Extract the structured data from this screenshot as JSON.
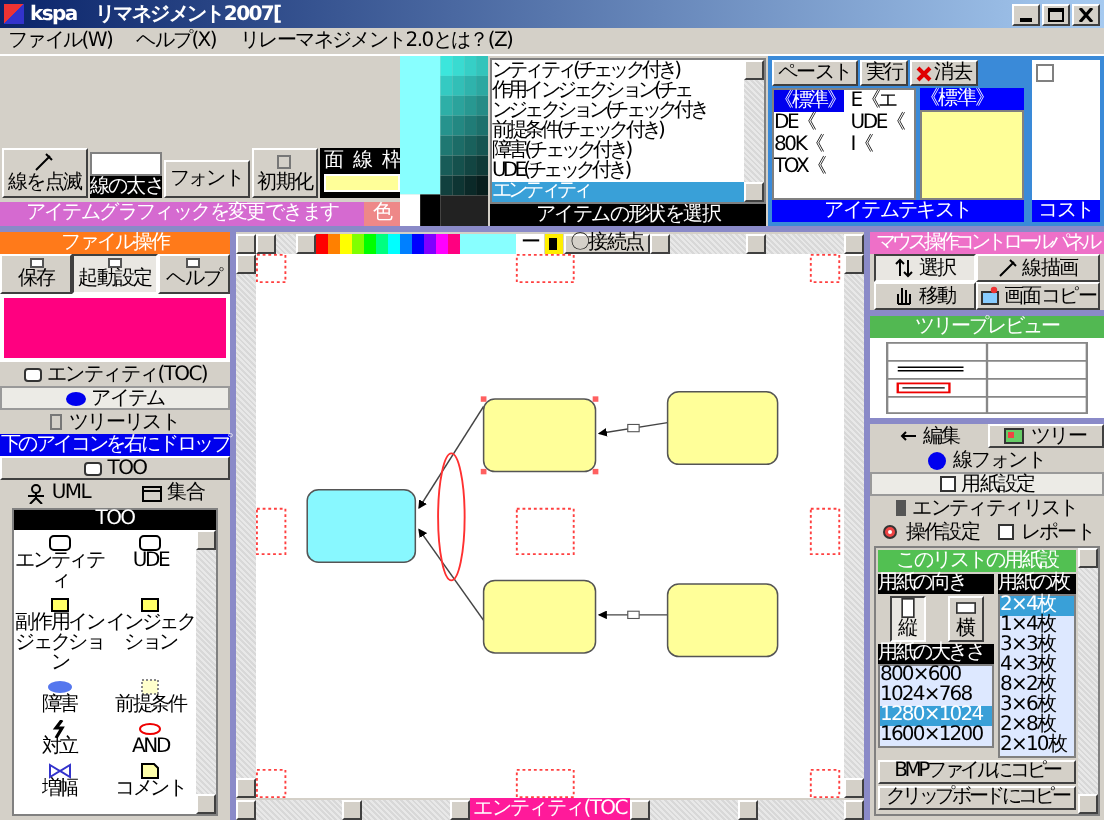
{
  "window": {
    "title": "kspa　リマネジメント2007["
  },
  "menu": [
    {
      "label": "ファイル(W)"
    },
    {
      "label": "ヘルプ(X)"
    },
    {
      "label": "リレーマネジメント2.0とは？(Z)"
    }
  ],
  "graphic_tools": {
    "blink_button": "線を点滅",
    "line_width_label": "線の太さ",
    "font_button": "フォント",
    "reset_button": "初期化",
    "swatch_labels": [
      "面",
      "線",
      "枠"
    ],
    "banner": "アイテムグラフィックを変更できます",
    "color_label": "色"
  },
  "shape_list": {
    "items": [
      {
        "label": "ンティティ(チェック付き)",
        "selected": false
      },
      {
        "label": "作用インジェクション(チェ",
        "selected": false
      },
      {
        "label": "ンジェクション(チェック付き",
        "selected": false
      },
      {
        "label": "前提条件(チェック付き)",
        "selected": false
      },
      {
        "label": "障害(チェック付き)",
        "selected": false
      },
      {
        "label": "UDE(チェック付き)",
        "selected": false
      },
      {
        "label": "エンティティ",
        "selected": true
      }
    ],
    "caption": "アイテムの形状を選択"
  },
  "item_text": {
    "styles": [
      {
        "label": "《標準》",
        "selected": true
      },
      {
        "label": "E《エ",
        "selected": false
      },
      {
        "label": "DE《",
        "selected": false
      },
      {
        "label": "UDE《",
        "selected": false
      },
      {
        "label": "80K《",
        "selected": false
      },
      {
        "label": "I《",
        "selected": false
      },
      {
        "label": "TOX《",
        "selected": false
      }
    ],
    "buttons": [
      "ペースト",
      "実行",
      "消去"
    ],
    "current_style": "《標準》",
    "caption": "アイテムテキスト"
  },
  "cost": {
    "checked": false,
    "caption": "コスト"
  },
  "file_panel": {
    "title": "ファイル操作",
    "buttons": [
      {
        "label": "保存",
        "selected": false
      },
      {
        "label": "起動設定",
        "selected": true
      },
      {
        "label": "ヘルプ",
        "selected": false
      }
    ]
  },
  "modes": [
    {
      "label": "エンティティ(TOC)",
      "kind": "entity",
      "selected": false
    },
    {
      "label": "アイテム",
      "kind": "item",
      "selected": true
    },
    {
      "label": "ツリーリスト",
      "kind": "tree",
      "selected": false
    }
  ],
  "drop_hint": "下のアイコンを右にドロップ",
  "too_button": "TOO",
  "categories": [
    {
      "label": "UML",
      "kind": "uml"
    },
    {
      "label": "集合",
      "kind": "set"
    }
  ],
  "palette": {
    "title": "TOO",
    "items": [
      {
        "label": "エンティティ",
        "kind": "entity"
      },
      {
        "label": "UDE",
        "kind": "ude"
      },
      {
        "label": "副作用インジェクション",
        "kind": "side"
      },
      {
        "label": "インジェクション",
        "kind": "injection"
      },
      {
        "label": "障害",
        "kind": "obstacle"
      },
      {
        "label": "前提条件",
        "kind": "precondition"
      },
      {
        "label": "対立",
        "kind": "conflict"
      },
      {
        "label": "AND",
        "kind": "and"
      },
      {
        "label": "増幅",
        "kind": "amplifier"
      },
      {
        "label": "コメント",
        "kind": "comment"
      }
    ]
  },
  "canvas": {
    "swatches": [
      {
        "color": "#ff0000"
      },
      {
        "color": "#ff8000"
      },
      {
        "color": "#ffff00"
      },
      {
        "color": "#80ff00"
      },
      {
        "color": "#00ff00"
      },
      {
        "color": "#00ff80"
      },
      {
        "color": "#00ffff"
      },
      {
        "color": "#0080ff"
      },
      {
        "color": "#0000ff"
      },
      {
        "color": "#8000ff"
      },
      {
        "color": "#ff00ff"
      },
      {
        "color": "#ff0080"
      }
    ],
    "line_field": "ー",
    "connect_button": "〇接続点",
    "diagram": {
      "root": {
        "color": "#88f8ff",
        "selected": false,
        "and_connector": true,
        "children": [
          {
            "color": "#ffff99",
            "selected": true,
            "children": [
              {
                "color": "#ffff99",
                "selected": false
              }
            ]
          },
          {
            "color": "#ffff99",
            "selected": false,
            "children": [
              {
                "color": "#ffff99",
                "selected": false
              }
            ]
          }
        ]
      }
    },
    "page_label": "エンティティ(TOC"
  },
  "mouse_panel": {
    "title": "マウス操作コントロールパネル",
    "buttons": [
      {
        "label": "選択",
        "kind": "select",
        "selected": true
      },
      {
        "label": "線描画",
        "kind": "draw",
        "selected": false
      },
      {
        "label": "移動",
        "kind": "move",
        "selected": false
      },
      {
        "label": "画面コピー",
        "kind": "copy",
        "selected": false
      }
    ]
  },
  "tree_preview": {
    "title": "ツリープレビュー"
  },
  "tabs": [
    {
      "label": "編集",
      "kind": "edit",
      "selected": true
    },
    {
      "label": "ツリー",
      "kind": "tree",
      "selected": false
    }
  ],
  "options": [
    {
      "label": "線フォント",
      "kind": "dot"
    },
    {
      "label": "用紙設定",
      "kind": "page"
    },
    {
      "label": "エンティティリスト",
      "kind": "list"
    }
  ],
  "settings_buttons": [
    {
      "label": "操作設定",
      "kind": "gear"
    },
    {
      "label": "レポート",
      "kind": "page"
    }
  ],
  "paper": {
    "title": "このリストの用紙設",
    "orientation_label": "用紙の向き",
    "orientations": [
      {
        "label": "縦",
        "kind": "portrait",
        "selected": true
      },
      {
        "label": "横",
        "kind": "landscape",
        "selected": false
      }
    ],
    "size_label": "用紙の大きさ",
    "sizes": [
      {
        "label": "800×600",
        "selected": false
      },
      {
        "label": "1024×768",
        "selected": false
      },
      {
        "label": "1280×1024",
        "selected": true
      },
      {
        "label": "1600×1200",
        "selected": false
      }
    ],
    "count_label": "用紙の枚",
    "counts": [
      {
        "label": "2×4枚",
        "selected": true
      },
      {
        "label": "1×4枚",
        "selected": false
      },
      {
        "label": "3×3枚",
        "selected": false
      },
      {
        "label": "4×3枚",
        "selected": false
      },
      {
        "label": "8×2枚",
        "selected": false
      },
      {
        "label": "3×6枚",
        "selected": false
      },
      {
        "label": "2×8枚",
        "selected": false
      },
      {
        "label": "2×10枚",
        "selected": false
      }
    ],
    "buttons": [
      "BMPファイルにコピー",
      "クリップボードにコピー"
    ]
  }
}
